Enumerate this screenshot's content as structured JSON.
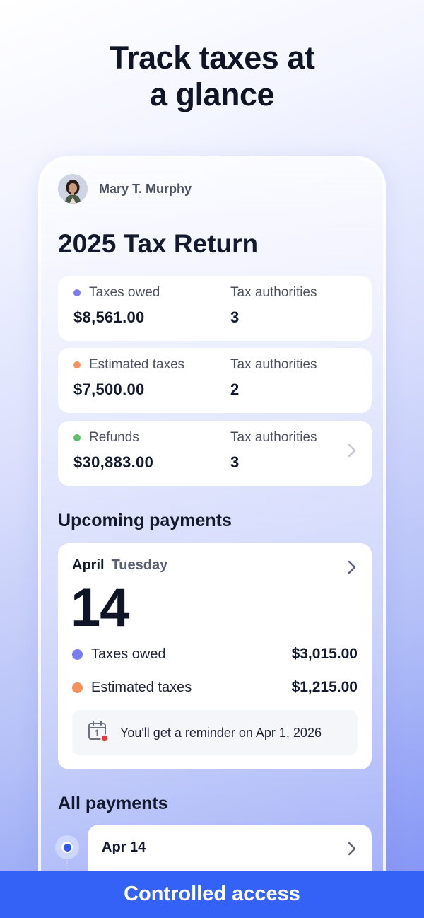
{
  "headline": {
    "line1": "Track taxes at",
    "line2": "a glance"
  },
  "user": {
    "name": "Mary T. Murphy"
  },
  "return_title": "2025 Tax Return",
  "summary": [
    {
      "label": "Taxes owed",
      "dot_color": "#7c7cf2",
      "amount": "$8,561.00",
      "authorities_label": "Tax authorities",
      "authorities_count": "3"
    },
    {
      "label": "Estimated taxes",
      "dot_color": "#f2905e",
      "amount": "$7,500.00",
      "authorities_label": "Tax authorities",
      "authorities_count": "2"
    },
    {
      "label": "Refunds",
      "dot_color": "#5cbf63",
      "amount": "$30,883.00",
      "authorities_label": "Tax authorities",
      "authorities_count": "3"
    }
  ],
  "upcoming": {
    "section_title": "Upcoming payments",
    "month": "April",
    "weekday": "Tuesday",
    "day": "14",
    "payments": [
      {
        "label": "Taxes owed",
        "dot_color": "#7c7cf2",
        "amount": "$3,015.00"
      },
      {
        "label": "Estimated taxes",
        "dot_color": "#f2905e",
        "amount": "$1,215.00"
      }
    ],
    "reminder": "You'll get a reminder on Apr 1, 2026"
  },
  "all_payments": {
    "section_title": "All payments",
    "first_date": "Apr 14"
  },
  "bottom_banner": "Controlled access",
  "icons": {
    "avatar": "user-avatar",
    "chevron": "chevron-right-icon",
    "calendar": "calendar-reminder-icon"
  },
  "colors": {
    "accent": "#3462f6",
    "timeline_core": "#2f5be8",
    "reminder_dot": "#e23b3b"
  }
}
